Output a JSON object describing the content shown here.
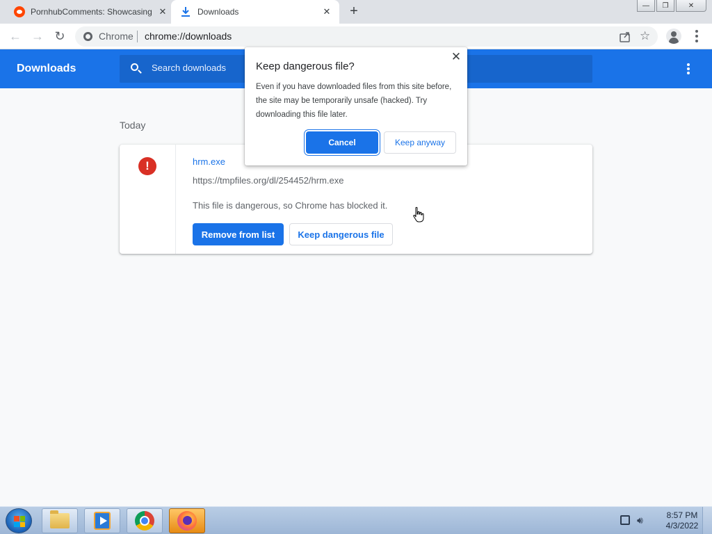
{
  "tabs": [
    {
      "title": "PornhubComments: Showcasing",
      "icon": "reddit-icon",
      "active": false
    },
    {
      "title": "Downloads",
      "icon": "download-icon",
      "active": true
    }
  ],
  "window_controls": {
    "minimize": "—",
    "restore": "❐",
    "close": "✕"
  },
  "toolbar": {
    "back": "←",
    "forward": "→",
    "reload": "↻",
    "omnibox_scheme": "Chrome",
    "omnibox_url": "chrome://downloads"
  },
  "downloads_page": {
    "title": "Downloads",
    "search_placeholder": "Search downloads",
    "section_date": "Today",
    "items": [
      {
        "file_name": "hrm.exe",
        "url": "https://tmpfiles.org/dl/254452/hrm.exe",
        "status": "This file is dangerous, so Chrome has blocked it.",
        "remove_label": "Remove from list",
        "keep_label": "Keep dangerous file",
        "danger_glyph": "!"
      }
    ]
  },
  "dialog": {
    "title": "Keep dangerous file?",
    "body": "Even if you have downloaded files from this site before, the site may be temporarily unsafe (hacked). Try downloading this file later.",
    "cancel_label": "Cancel",
    "keep_label": "Keep anyway"
  },
  "taskbar": {
    "apps": [
      "file-explorer",
      "windows-media-player",
      "google-chrome",
      "firefox"
    ],
    "time": "8:57 PM",
    "date": "4/3/2022"
  },
  "colors": {
    "accent": "#1a73e8",
    "danger": "#d93025",
    "header_search_bg": "#1765cc"
  }
}
